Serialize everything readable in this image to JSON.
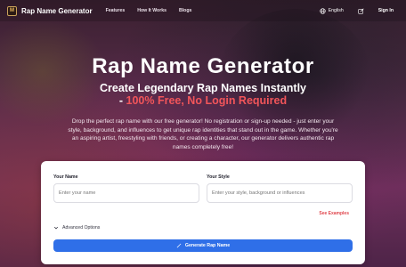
{
  "colors": {
    "accent": "#2f6fe8",
    "highlight": "#f2555a",
    "examples_link": "#e0474e",
    "background": "#5a2d4c"
  },
  "header": {
    "logo_icon": "microphone-logo-icon",
    "logo_glyph": "M",
    "brand": "Rap Name Generator",
    "nav": [
      "Features",
      "How It Works",
      "Blogs"
    ],
    "language": "English",
    "language_icon": "globe-icon",
    "edit_icon": "edit-icon",
    "signin": "Sign In"
  },
  "hero": {
    "title": "Rap Name Generator",
    "subtitle": "Create Legendary Rap Names Instantly",
    "subtitle2_prefix": "- ",
    "subtitle2_highlight": "100% Free, No Login Required",
    "description": "Drop the perfect rap name with our free generator! No registration or sign-up needed - just enter your style, background, and influences to get unique rap identities that stand out in the game. Whether you're an aspiring artist, freestyling with friends, or creating a character, our generator delivers authentic rap names completely free!"
  },
  "form": {
    "name_label": "Your Name",
    "name_placeholder": "Enter your name",
    "name_value": "",
    "style_label": "Your Style",
    "style_placeholder": "Enter your style, background or influences",
    "style_value": "",
    "see_examples": "See Examples",
    "advanced": "Advanced Options",
    "advanced_icon": "chevron-down-icon",
    "generate": "Generate Rap Name",
    "generate_icon": "magic-wand-icon"
  }
}
